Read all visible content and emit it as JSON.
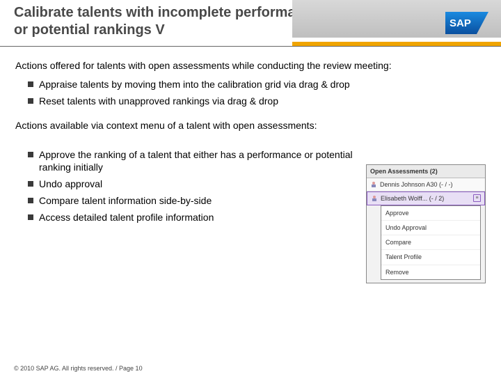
{
  "header": {
    "title": "Calibrate talents with incomplete performance and/ or potential rankings V",
    "brand": "SAP"
  },
  "section1": {
    "intro": "Actions offered for talents with open assessments while conducting the review meeting:",
    "bullets": [
      "Appraise talents by moving them into the calibration grid via drag & drop",
      "Reset talents with unapproved rankings via drag & drop"
    ]
  },
  "section2": {
    "intro": "Actions available via context menu of a talent with open assessments:",
    "bullets": [
      "Approve the ranking of a talent that either has a performance or potential ranking initially",
      "Undo approval",
      "Compare talent information side-by-side",
      "Access detailed talent profile information"
    ]
  },
  "screenshot": {
    "panel_title": "Open Assessments (2)",
    "row1_name": "Dennis Johnson A30 (- / -)",
    "row2_name": "Elisabeth Wolff... (- / 2)",
    "menu": [
      "Approve",
      "Undo Approval",
      "Compare",
      "Talent Profile",
      "Remove"
    ]
  },
  "footer": "© 2010 SAP AG. All rights reserved. / Page 10"
}
